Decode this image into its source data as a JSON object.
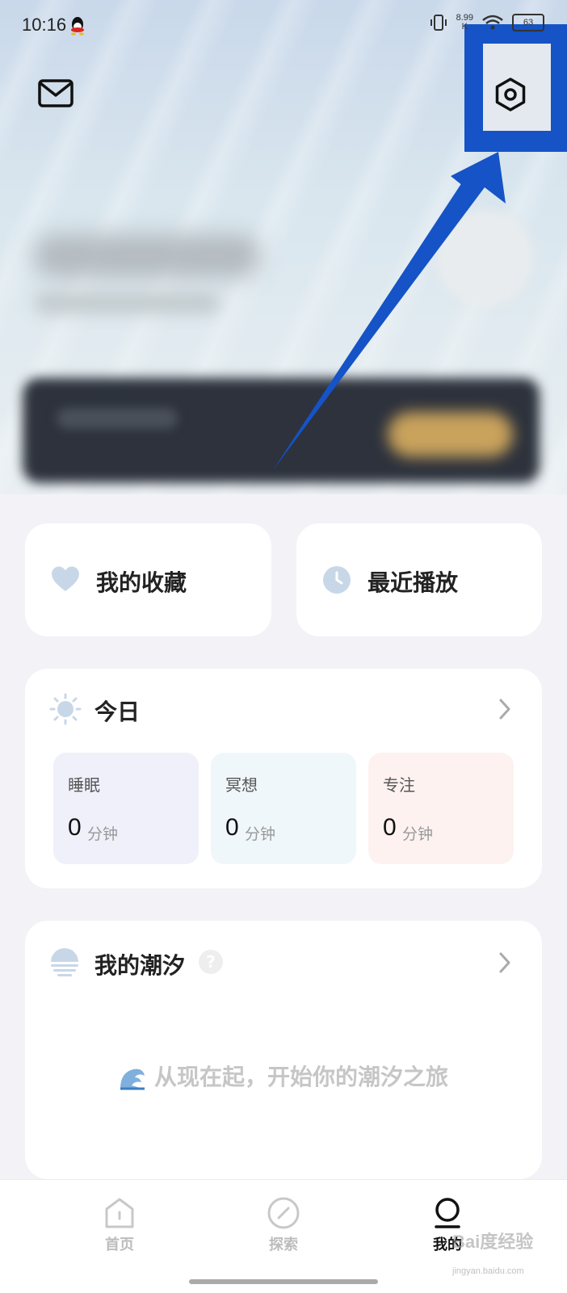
{
  "status_bar": {
    "time": "10:16",
    "network_speed": "8.99",
    "battery": "63"
  },
  "quick_actions": [
    {
      "label": "我的收藏",
      "icon": "heart-icon"
    },
    {
      "label": "最近播放",
      "icon": "clock-icon"
    }
  ],
  "today": {
    "title": "今日",
    "stats": [
      {
        "name": "睡眠",
        "value": "0",
        "unit": "分钟",
        "color": "#f0f0fb"
      },
      {
        "name": "冥想",
        "value": "0",
        "unit": "分钟",
        "color": "#f0f7fb"
      },
      {
        "name": "专注",
        "value": "0",
        "unit": "分钟",
        "color": "#fdf2f0"
      }
    ]
  },
  "tide": {
    "title": "我的潮汐",
    "help": "?",
    "empty_text": "从现在起，开始你的潮汐之旅"
  },
  "bottom_nav": [
    {
      "label": "首页",
      "icon": "home-icon",
      "active": false
    },
    {
      "label": "探索",
      "icon": "compass-icon",
      "active": false
    },
    {
      "label": "我的",
      "icon": "profile-icon",
      "active": true
    }
  ],
  "watermark": {
    "brand": "Bai度经验",
    "url": "jingyan.baidu.com"
  },
  "colors": {
    "highlight": "#1553c6",
    "accent_icon": "#c8d7e8"
  }
}
